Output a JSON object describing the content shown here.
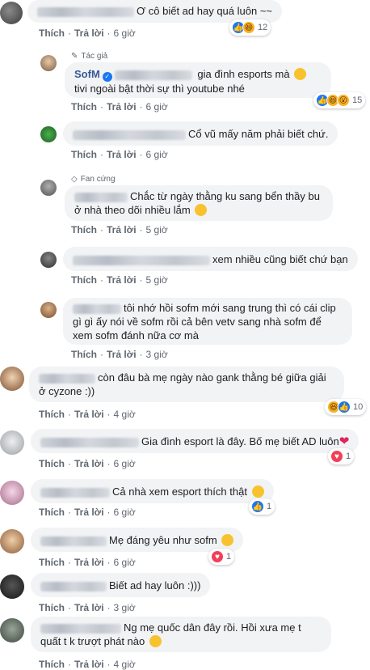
{
  "labels": {
    "like": "Thích",
    "reply": "Trả lời",
    "dot": "·"
  },
  "comments": [
    {
      "text": "Ơ cô biết ad hay quá luôn ~~",
      "time": "6 giờ",
      "reacts": "12"
    },
    {
      "badge": "Tác giả",
      "author": "SofM",
      "text": " gia đình esports mà ",
      "text2": " tivi ngoài bật thời sự thì youtube nhé",
      "time": "6 giờ",
      "reacts": "15"
    },
    {
      "text": "Cổ vũ mấy năm phải biết chứ.",
      "time": "6 giờ"
    },
    {
      "badge": "Fan cứng",
      "text": "Chắc từ ngày thằng ku sang bển thầy bu ở nhà theo dõi nhiều lắm ",
      "time": "5 giờ"
    },
    {
      "text": "xem nhiều cũng biết chứ bạn",
      "time": "5 giờ"
    },
    {
      "text": "tôi nhớ hồi sofm mới sang trung thì có cái clip gì gì ấy nói về sofm rồi cả bên vetv sang nhà sofm để xem sofm đánh nữa cơ mà",
      "time": "3 giờ"
    },
    {
      "text": "còn đâu bà mẹ ngày nào gank thằng bé giữa giải ở cyzone :))",
      "time": "4 giờ",
      "reacts": "10"
    },
    {
      "text": "Gia đình esport là đây. Bố mẹ biết AD luôn",
      "time": "6 giờ",
      "reacts": "1"
    },
    {
      "text": "Cả nhà xem esport thích thật ",
      "time": "6 giờ",
      "reacts": "1"
    },
    {
      "text": "Mẹ đáng yêu như sofm ",
      "time": "6 giờ",
      "reacts": "1"
    },
    {
      "text": "Biết ad hay luôn :)))",
      "time": "3 giờ"
    },
    {
      "text": "Ng mẹ quốc dân đây rồi. Hồi xưa mẹ t quất t k trượt phát nào ",
      "time": "4 giờ"
    }
  ],
  "colors": {
    "like": "#1877f2",
    "haha": "#f7b125",
    "love": "#f33e58",
    "bubble": "#f2f3f5",
    "author": "#385898"
  }
}
